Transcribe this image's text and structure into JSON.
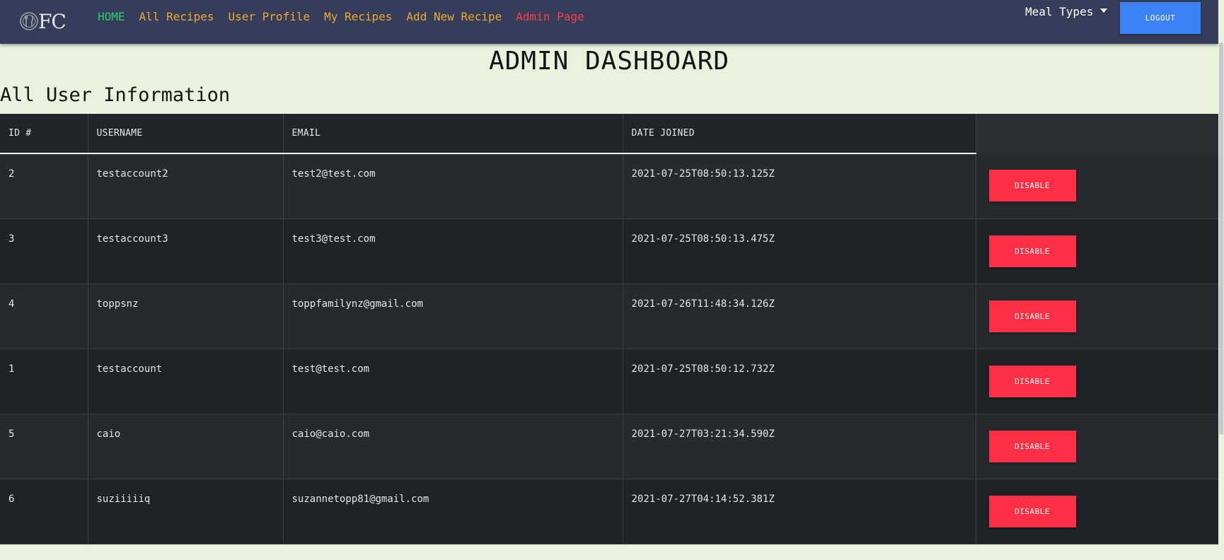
{
  "navbar": {
    "logo_text": "FC",
    "links": [
      {
        "label": "HOME",
        "color": "#2ecc71"
      },
      {
        "label": "All Recipes",
        "color": "#f0a830"
      },
      {
        "label": "User Profile",
        "color": "#f0a830"
      },
      {
        "label": "My Recipes",
        "color": "#f0a830"
      },
      {
        "label": "Add New Recipe",
        "color": "#f0a830"
      },
      {
        "label": "Admin Page",
        "color": "#ff3b4a"
      }
    ],
    "meal_types_label": "Meal Types",
    "logout_label": "LOGOUT"
  },
  "page_title": "ADMIN DASHBOARD",
  "section_title": "All User Information",
  "table": {
    "headers": [
      "ID #",
      "USERNAME",
      "EMAIL",
      "DATE JOINED",
      ""
    ],
    "rows": [
      {
        "id": "2",
        "username": "testaccount2",
        "email": "test2@test.com",
        "date_joined": "2021-07-25T08:50:13.125Z",
        "action": "DISABLE"
      },
      {
        "id": "3",
        "username": "testaccount3",
        "email": "test3@test.com",
        "date_joined": "2021-07-25T08:50:13.475Z",
        "action": "DISABLE"
      },
      {
        "id": "4",
        "username": "toppsnz",
        "email": "toppfamilynz@gmail.com",
        "date_joined": "2021-07-26T11:48:34.126Z",
        "action": "DISABLE"
      },
      {
        "id": "1",
        "username": "testaccount",
        "email": "test@test.com",
        "date_joined": "2021-07-25T08:50:12.732Z",
        "action": "DISABLE"
      },
      {
        "id": "5",
        "username": "caio",
        "email": "caio@caio.com",
        "date_joined": "2021-07-27T03:21:34.590Z",
        "action": "DISABLE"
      },
      {
        "id": "6",
        "username": "suziiiiiq",
        "email": "suzannetopp81@gmail.com",
        "date_joined": "2021-07-27T04:14:52.381Z",
        "action": "DISABLE"
      }
    ]
  },
  "colors": {
    "navbar_bg": "#353d5a",
    "page_bg": "#e8f2dc",
    "logout_bg": "#3b82f6",
    "disable_bg": "#ff2f45"
  }
}
